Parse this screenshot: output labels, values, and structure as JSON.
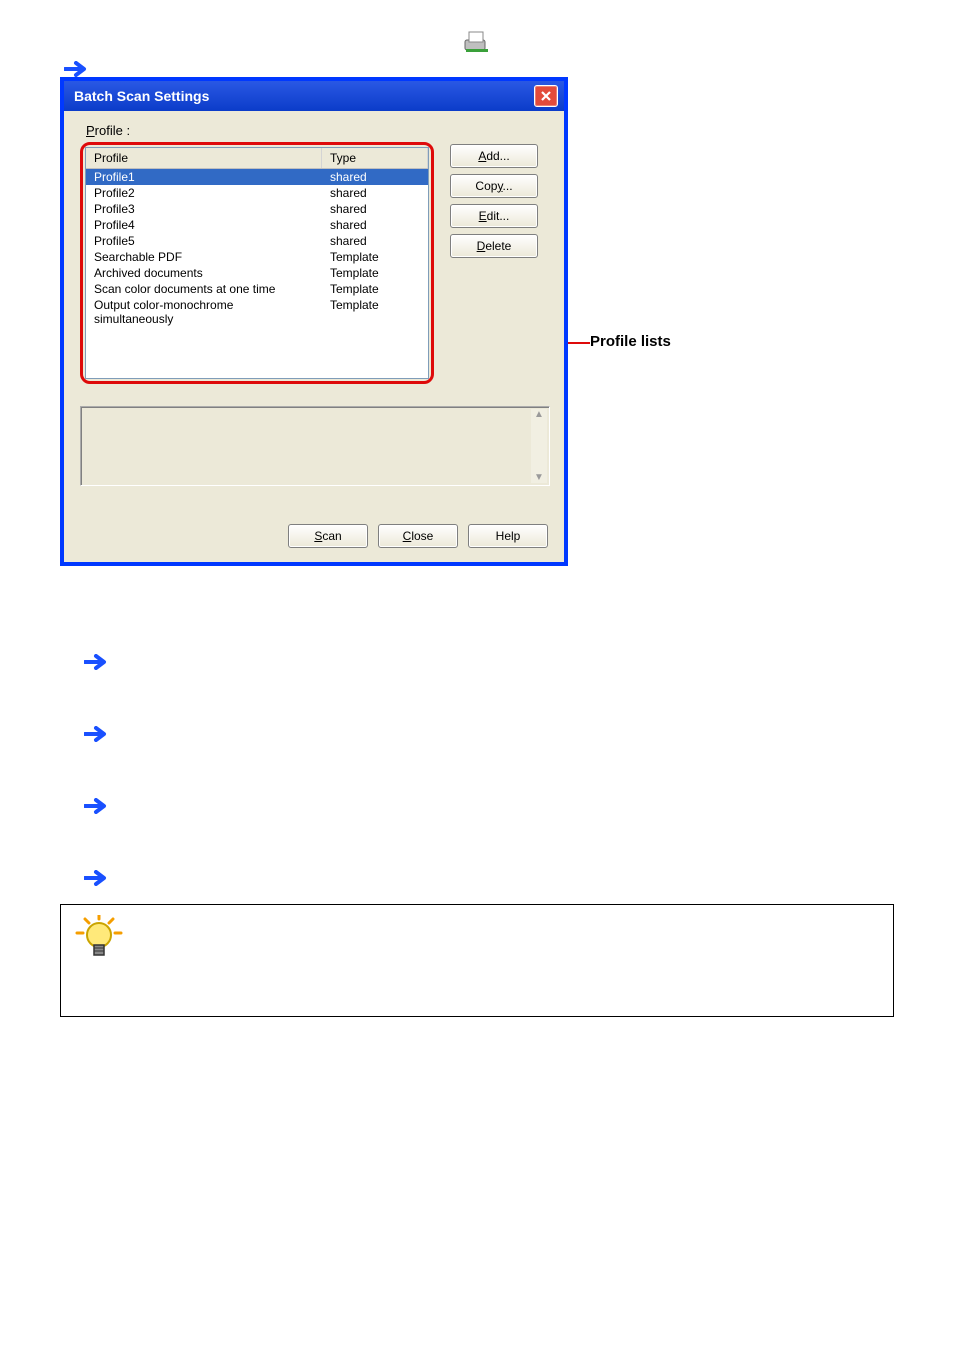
{
  "dialog": {
    "title": "Batch Scan Settings",
    "profile_label_prefix_ul": "P",
    "profile_label_rest": "rofile :",
    "columns": {
      "name": "Profile",
      "type": "Type"
    },
    "rows": [
      {
        "name": "Profile1",
        "type": "shared",
        "selected": true
      },
      {
        "name": "Profile2",
        "type": "shared",
        "selected": false
      },
      {
        "name": "Profile3",
        "type": "shared",
        "selected": false
      },
      {
        "name": "Profile4",
        "type": "shared",
        "selected": false
      },
      {
        "name": "Profile5",
        "type": "shared",
        "selected": false
      },
      {
        "name": "Searchable PDF",
        "type": "Template",
        "selected": false
      },
      {
        "name": "Archived documents",
        "type": "Template",
        "selected": false
      },
      {
        "name": "Scan color documents at one time",
        "type": "Template",
        "selected": false
      },
      {
        "name": "Output color-monochrome simultaneously",
        "type": "Template",
        "selected": false
      }
    ],
    "buttons": {
      "add_ul": "A",
      "add_rest": "dd...",
      "copy_pre": "Cop",
      "copy_ul": "y",
      "copy_rest": "...",
      "edit_ul": "E",
      "edit_rest": "dit...",
      "delete_ul": "D",
      "delete_rest": "elete",
      "scan_ul": "S",
      "scan_rest": "can",
      "close_ul": "C",
      "close_rest": "lose",
      "help": "Help"
    }
  },
  "annotation": "Profile lists"
}
